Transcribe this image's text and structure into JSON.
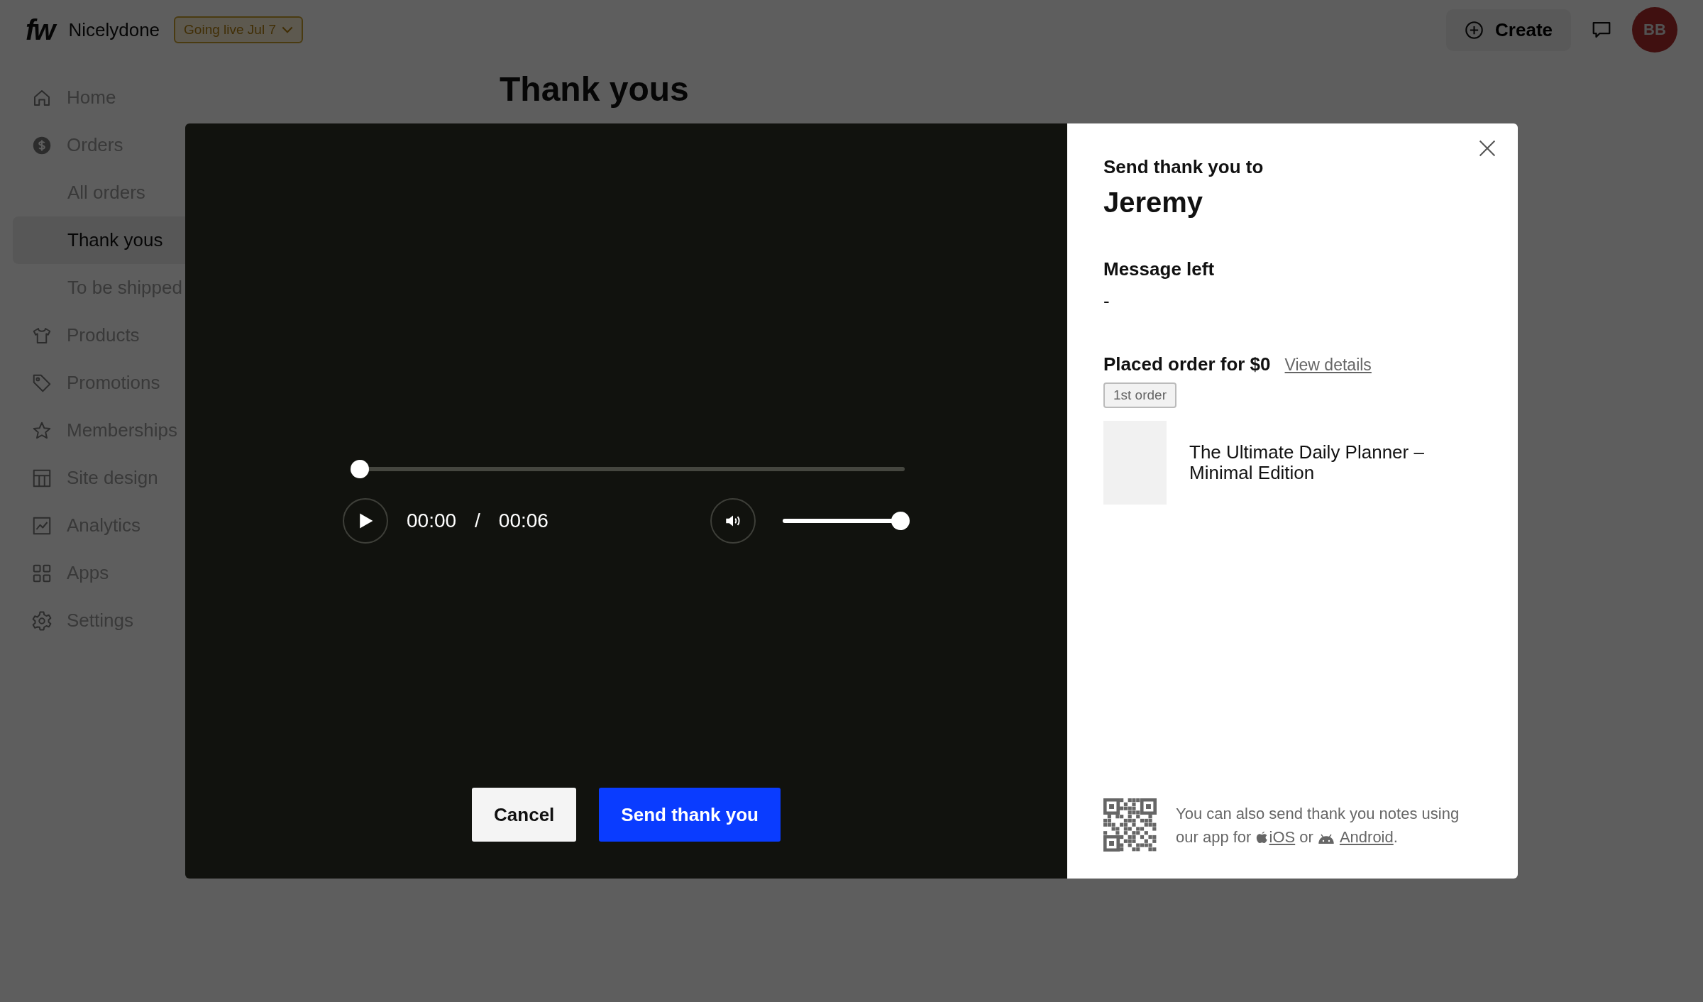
{
  "header": {
    "logo": "fw",
    "workspace": "Nicelydone",
    "launch_badge": "Going live Jul 7",
    "create_button": "Create",
    "avatar": "BB"
  },
  "sidebar": {
    "items": [
      {
        "label": "Home",
        "kind": "home",
        "selected": false
      },
      {
        "label": "Orders",
        "kind": "dollar",
        "selected": false,
        "children": [
          {
            "label": "All orders",
            "selected": false
          },
          {
            "label": "Thank yous",
            "selected": true
          },
          {
            "label": "To be shipped",
            "selected": false
          }
        ]
      },
      {
        "label": "Products",
        "kind": "shirt",
        "selected": false
      },
      {
        "label": "Promotions",
        "kind": "tag",
        "selected": false
      },
      {
        "label": "Memberships",
        "kind": "star",
        "selected": false
      },
      {
        "label": "Site design",
        "kind": "layout",
        "selected": false
      },
      {
        "label": "Analytics",
        "kind": "chart",
        "selected": false
      },
      {
        "label": "Apps",
        "kind": "grid",
        "selected": false
      },
      {
        "label": "Settings",
        "kind": "gear",
        "selected": false
      }
    ]
  },
  "page": {
    "title": "Thank yous"
  },
  "modal": {
    "player": {
      "seek": {
        "level": 0
      },
      "current_time": "00:00",
      "separator": "/",
      "duration": "00:06",
      "volume": {
        "level": 1
      }
    },
    "buttons": [
      {
        "label": "Cancel",
        "kind": "secondary"
      },
      {
        "label": "Send thank you",
        "kind": "primary"
      }
    ],
    "details": {
      "heading": "Send thank you to",
      "recipient": "Jeremy",
      "message_label": "Message left",
      "message": "-",
      "order_label": "Placed order for $0",
      "order_link": "View details",
      "order_badge": "1st order",
      "product": {
        "name": "The Ultimate Daily Planner – Minimal Edition"
      }
    },
    "app_note": {
      "text": "You can also send thank you notes using our app for",
      "ios_link": "iOS",
      "connector": "or",
      "android_link": "Android",
      "end": "."
    }
  }
}
